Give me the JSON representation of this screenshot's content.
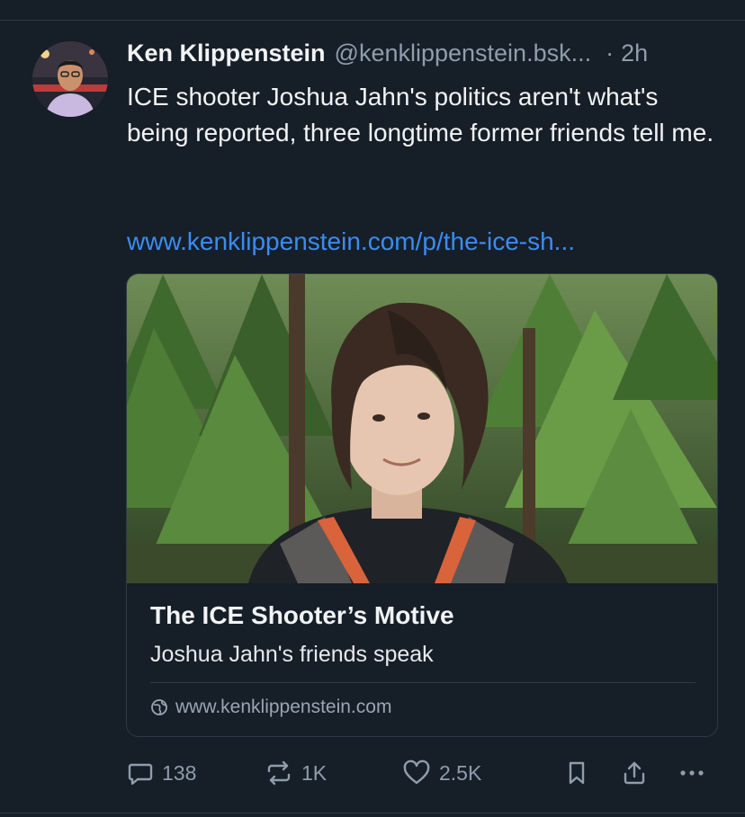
{
  "post": {
    "author_name": "Ken Klippenstein",
    "author_handle": "@kenklippenstein.bsk...",
    "separator": "·",
    "time": "2h",
    "text": "ICE shooter Joshua Jahn's politics aren't what's being reported, three longtime former friends tell me.",
    "link_text": "www.kenklippenstein.com/p/the-ice-sh..."
  },
  "link_card": {
    "title": "The ICE Shooter’s Motive",
    "description": "Joshua Jahn's friends speak",
    "domain": "www.kenklippenstein.com",
    "domain_icon": "globe-icon"
  },
  "actions": {
    "reply_count": "138",
    "reply_icon": "comment-icon",
    "repost_count": "1K",
    "repost_icon": "repost-icon",
    "like_count": "2.5K",
    "like_icon": "heart-icon",
    "bookmark_icon": "bookmark-icon",
    "share_icon": "share-icon",
    "more_icon": "more-icon"
  },
  "colors": {
    "background": "#161e27",
    "link": "#3b8cf2",
    "muted": "#8f9dac",
    "border": "#2e3a47"
  }
}
